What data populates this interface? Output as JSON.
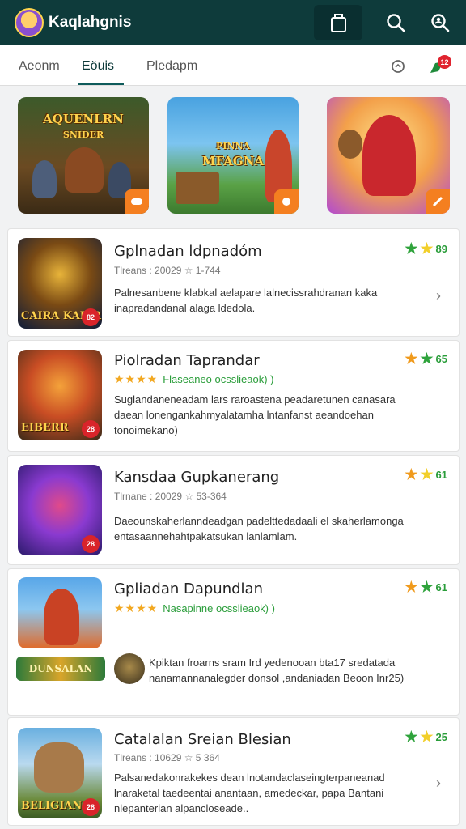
{
  "appbar": {
    "title": "Kaqlahgnis",
    "icons": [
      "avatar",
      "bag-icon",
      "search-icon",
      "search-person-icon"
    ]
  },
  "tabs": {
    "items": [
      {
        "label": "Aeonm",
        "active": false
      },
      {
        "label": "Eöuis",
        "active": true
      },
      {
        "label": "Pledapm",
        "active": false
      }
    ],
    "notifications": "12"
  },
  "featured": [
    {
      "title": "AQUENLRN",
      "subtitle": "SNIDER"
    },
    {
      "title": "MFAGNA",
      "subtitle": "PINNA"
    },
    {
      "title": "",
      "subtitle": ""
    }
  ],
  "games": [
    {
      "title": "Gplnadan ldpnadóm",
      "meta": "Tlreans : 20029 ☆ 1-744",
      "rating": "89",
      "description": "Palnesanbene klabkal aelapare lalnecissrahdranan kaka inapradandanal alaga ldedola.",
      "thumb_label": "CAIRA KAISR",
      "thumb_badge": "82"
    },
    {
      "title": "Piolradan Taprandar",
      "stars_text": "Flaseaneo ocsslieaok) )",
      "rating": "65",
      "description": "Suglandaneneadam lars raroastena peadaretunen canasara daean lonengankahmyalatamha lntanfanst aeandoehan tonoimekano)",
      "thumb_label": "EIBERR",
      "thumb_badge": "28"
    },
    {
      "title": "Kansdaa Gupkanerang",
      "meta": "Tlrnane : 20029 ☆ 53-364",
      "rating": "61",
      "description": "Daeounskaherlanndeadgan padelttedadaali el skaherlamonga entasaannehahtpakatsukan lanlamlam.",
      "thumb_label": "",
      "thumb_badge": "28"
    },
    {
      "title": "Gpliadan Dapundlan",
      "stars_text": "Nasapinne ocsslieaok) )",
      "rating": "61",
      "description": "Kpiktan froarns sram Ird yedenooan bta17 sredatada nanamannanalegder donsol ,andaniadan Beoon Inr25)",
      "thumb_label": "DUNSALAN",
      "thumb_badge": ""
    },
    {
      "title": "Catalalan Sreian Blesian",
      "meta": "Tlreans : 10629 ☆ 5 364",
      "rating": "25",
      "description": "Palsanedakonrakekes dean lnotandaclaseingterpaneanad lnaraketal taedeentai anantaan, amedeckar, papa Bantani nlepanterian alpancloseade..",
      "thumb_label": "BELIGIAN",
      "thumb_badge": "28"
    }
  ],
  "colors": {
    "appbar": "#0e3b3b",
    "star_green": "#2fa33c",
    "star_yellow": "#f2cf2a",
    "star_orange": "#f09a1c",
    "badge_red": "#e0242f"
  }
}
